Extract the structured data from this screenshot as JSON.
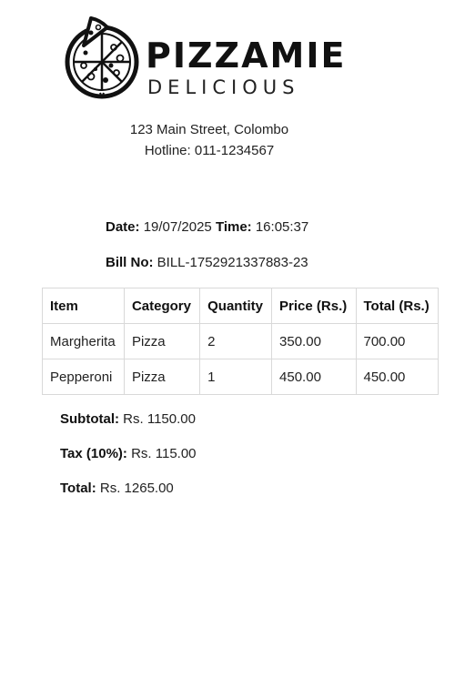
{
  "brand": {
    "name": "PIZZAMIE",
    "tagline": "DELICIOUS"
  },
  "store": {
    "address": "123 Main Street, Colombo",
    "hotline": "Hotline: 011-1234567"
  },
  "bill": {
    "date_label": "Date:",
    "date_value": "19/07/2025",
    "time_label": "Time:",
    "time_value": "16:05:37",
    "bill_no_label": "Bill No:",
    "bill_no_value": "BILL-1752921337883-23"
  },
  "table": {
    "headers": [
      "Item",
      "Category",
      "Quantity",
      "Price (Rs.)",
      "Total (Rs.)"
    ],
    "rows": [
      [
        "Margherita",
        "Pizza",
        "2",
        "350.00",
        "700.00"
      ],
      [
        "Pepperoni",
        "Pizza",
        "1",
        "450.00",
        "450.00"
      ]
    ]
  },
  "totals": {
    "subtotal_label": "Subtotal:",
    "subtotal_value": "Rs. 1150.00",
    "tax_label": "Tax (10%):",
    "tax_value": "Rs. 115.00",
    "total_label": "Total:",
    "total_value": "Rs. 1265.00"
  }
}
